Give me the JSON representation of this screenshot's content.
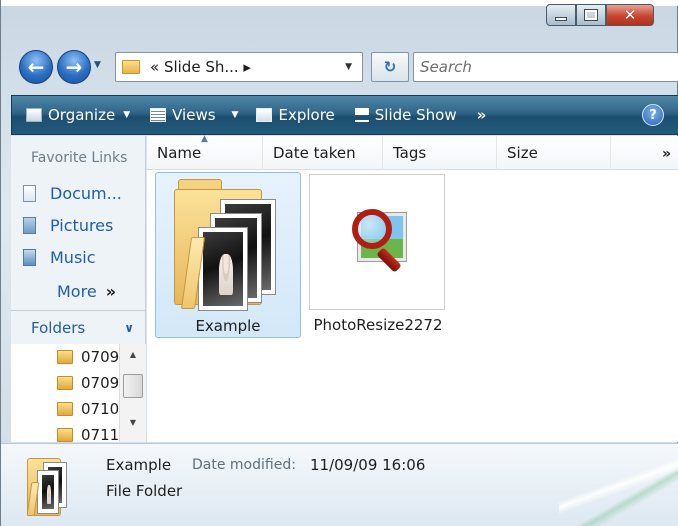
{
  "window": {
    "caption_minimize_icon": "minimize-icon",
    "caption_maximize_icon": "maximize-icon",
    "caption_close_icon": "close-icon",
    "close_color": "#c74632"
  },
  "nav": {
    "address_path": "« Slide Sh... ▸",
    "search_placeholder": "Search",
    "refresh_icon": "refresh-icon"
  },
  "toolbar": {
    "organize_label": "Organize",
    "views_label": "Views",
    "explore_label": "Explore",
    "slideshow_label": "Slide Show",
    "overflow_label": "»",
    "help_label": "?",
    "accent_color": "#2f6486"
  },
  "navpane": {
    "favorite_links_label": "Favorite Links",
    "favorites": [
      "Docum...",
      "Pictures",
      "Music"
    ],
    "more_label": "More",
    "more_glyph": "»",
    "folders_label": "Folders",
    "tree_items": [
      "0709",
      "0709",
      "0710",
      "0711"
    ]
  },
  "columns": {
    "headers": [
      "Name",
      "Date taken",
      "Tags",
      "Size"
    ],
    "sort_column": "Name",
    "overflow_label": "»"
  },
  "items": [
    {
      "name": "Example",
      "kind": "folder",
      "selected": true
    },
    {
      "name": "PhotoResize2272",
      "kind": "application",
      "selected": false
    }
  ],
  "details": {
    "name": "Example",
    "modified_label": "Date modified:",
    "modified_value": "11/09/09 16:06",
    "type": "File Folder"
  }
}
